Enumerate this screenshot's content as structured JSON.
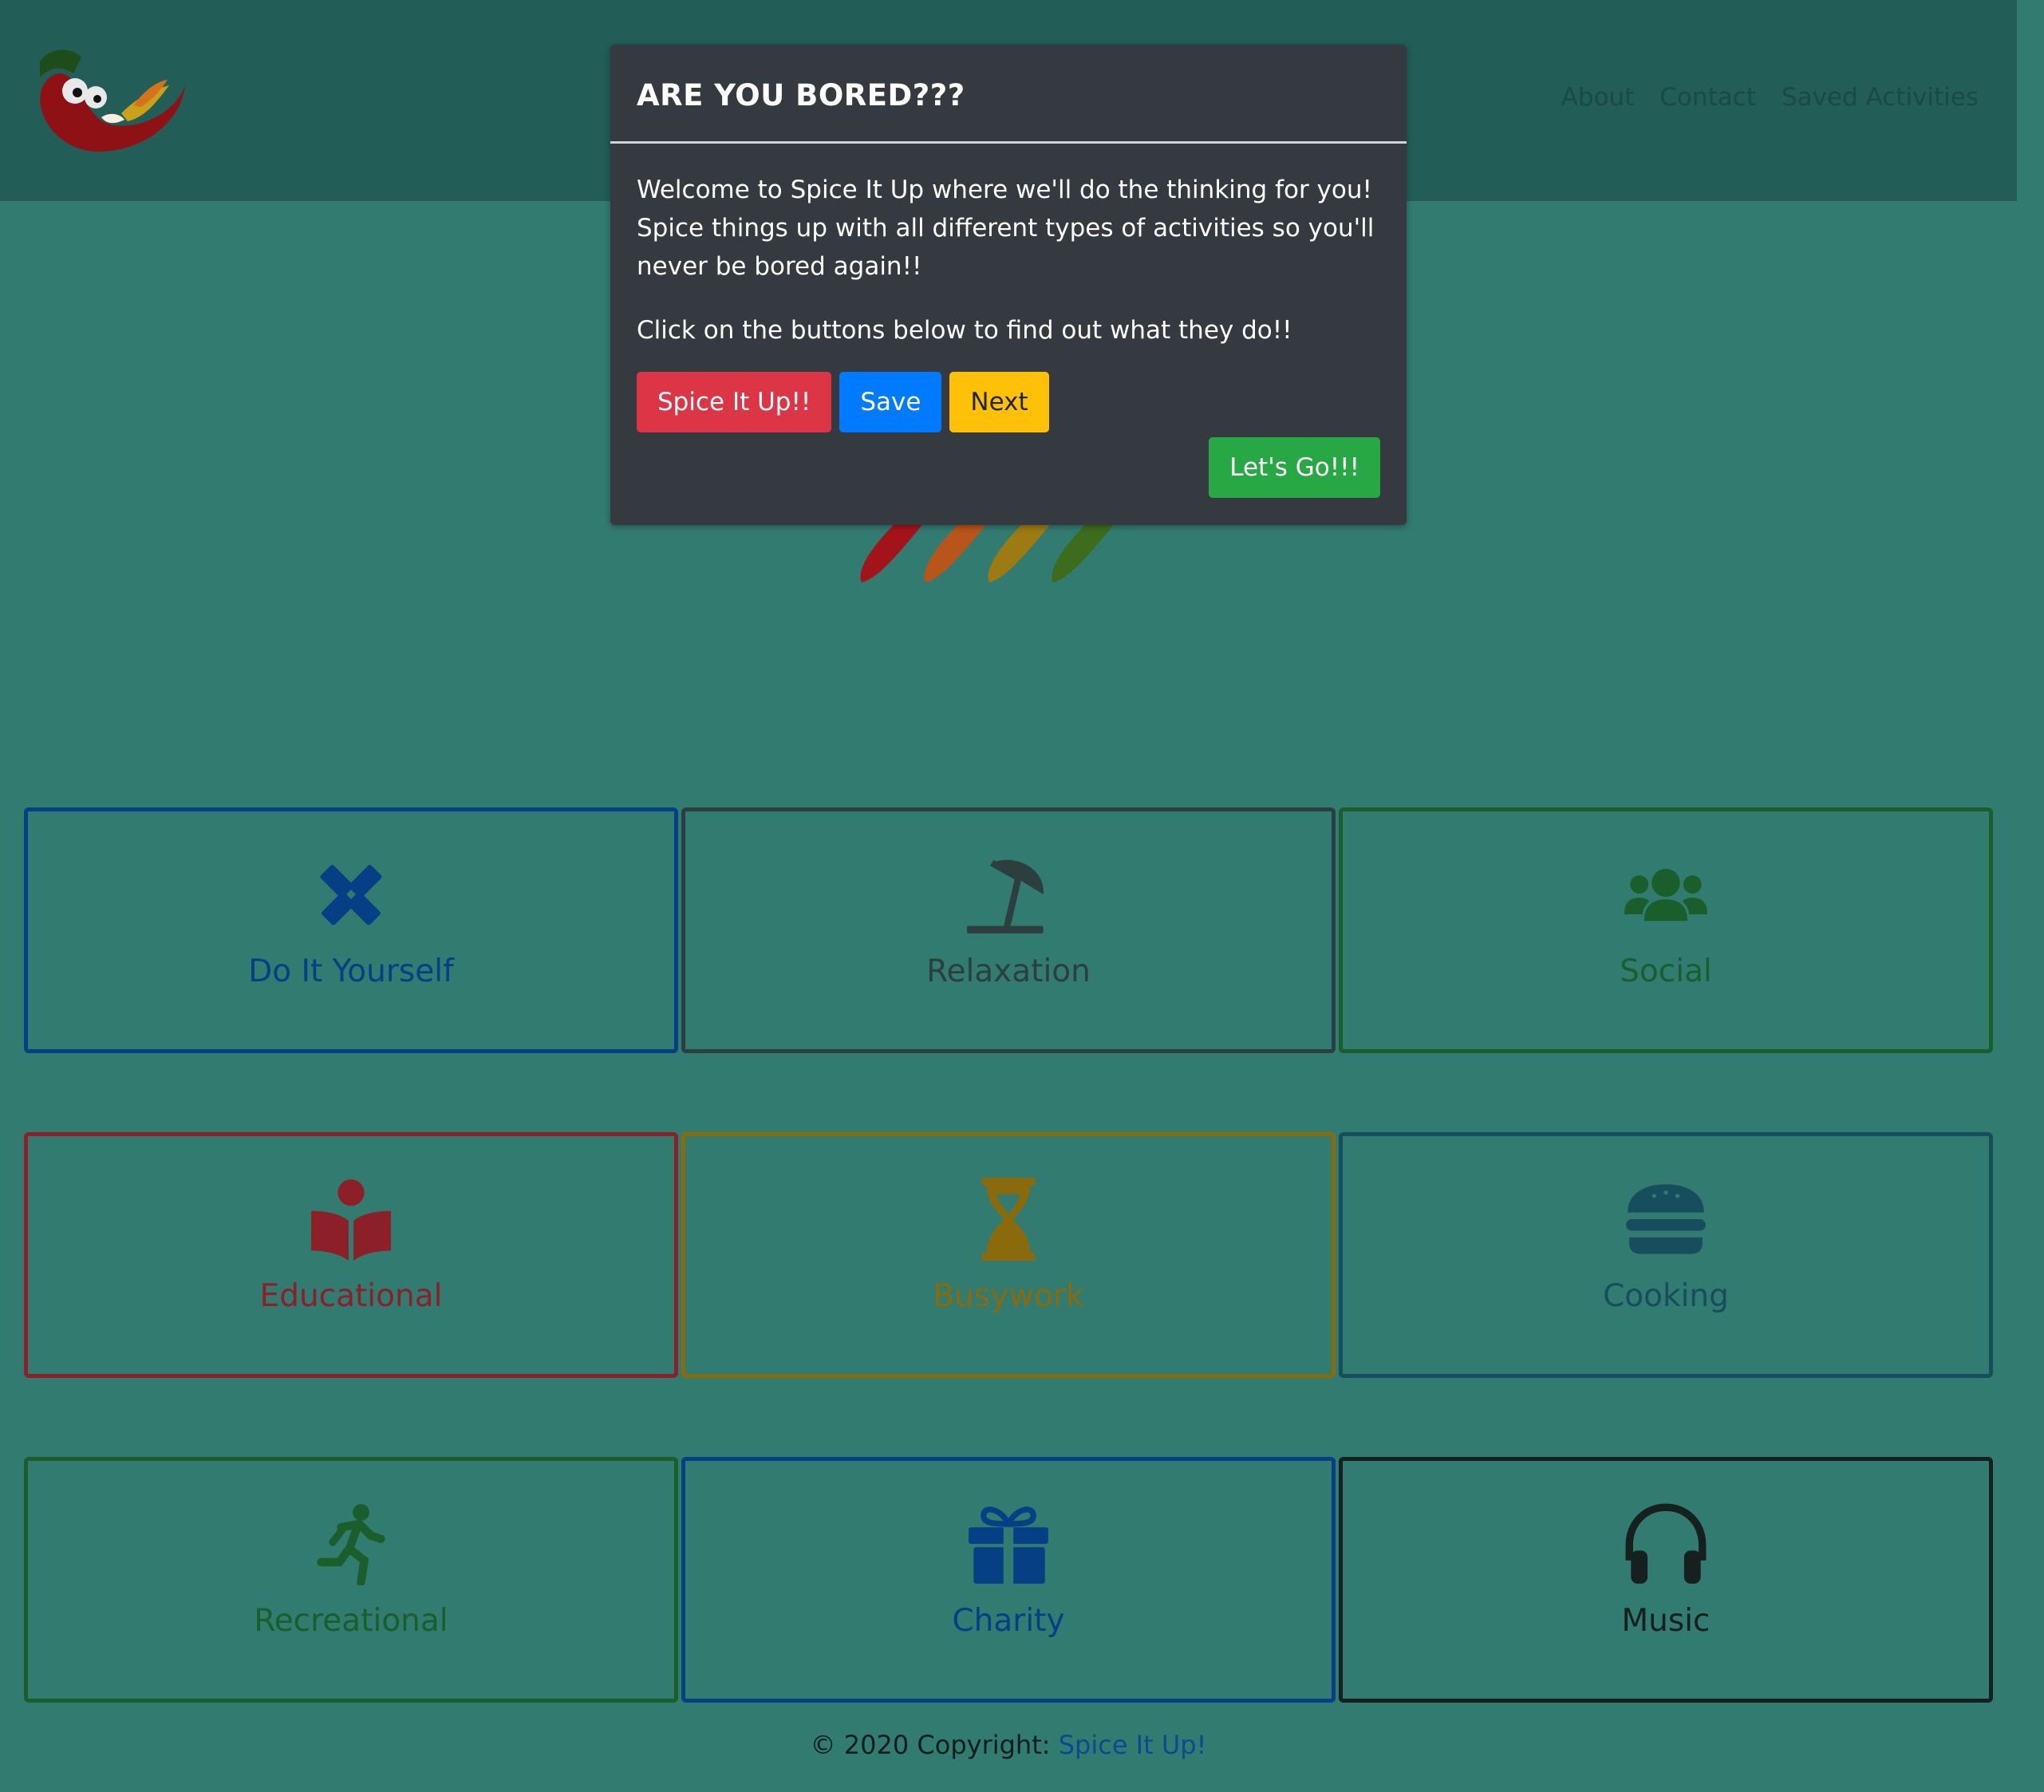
{
  "nav": {
    "links": [
      "About",
      "Contact",
      "Saved Activities"
    ]
  },
  "modal": {
    "title": "ARE YOU BORED???",
    "paragraph1": "Welcome to Spice It Up where we'll do the thinking for you! Spice things up with all different types of activities so you'll never be bored again!!",
    "paragraph2": "Click on the buttons below to find out what they do!!",
    "buttons": {
      "spice": "Spice It Up!!",
      "save": "Save",
      "next": "Next",
      "go": "Let's Go!!!"
    }
  },
  "categories": [
    {
      "label": "Do It Yourself",
      "icon": "pencil-ruler-icon",
      "color": "#073f85"
    },
    {
      "label": "Relaxation",
      "icon": "umbrella-beach-icon",
      "color": "#2d3e3e"
    },
    {
      "label": "Social",
      "icon": "users-icon",
      "color": "#1a5e2c"
    },
    {
      "label": "Educational",
      "icon": "book-reader-icon",
      "color": "#8c1f28"
    },
    {
      "label": "Busywork",
      "icon": "hourglass-icon",
      "color": "#8a6a0a"
    },
    {
      "label": "Cooking",
      "icon": "hamburger-icon",
      "color": "#174e5e"
    },
    {
      "label": "Recreational",
      "icon": "running-icon",
      "color": "#1a5e2c"
    },
    {
      "label": "Charity",
      "icon": "gift-icon",
      "color": "#073f85"
    },
    {
      "label": "Music",
      "icon": "headphones-icon",
      "color": "#15201f"
    }
  ],
  "footer": {
    "prefix": "© 2020 Copyright: ",
    "link": "Spice It Up!"
  }
}
